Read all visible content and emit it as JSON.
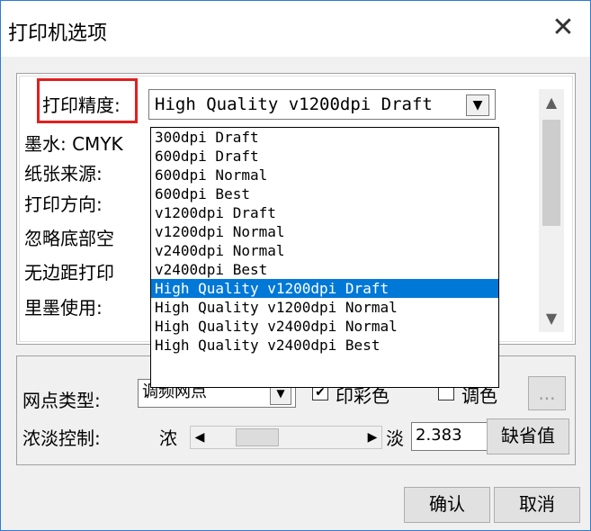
{
  "window": {
    "title": "打印机选项",
    "close_icon": "close-icon"
  },
  "settings": {
    "print_quality_label": "打印精度:",
    "print_quality_value": "High Quality v1200dpi Draft",
    "ink_label": "墨水: CMYK",
    "paper_source_label": "纸张来源:",
    "orientation_label": "打印方向:",
    "ignore_bottom_label": "忽略底部空",
    "borderless_label": "无边距打印",
    "black_ink_label": "里墨使用:"
  },
  "dropdown": {
    "options": [
      "300dpi Draft",
      "600dpi Draft",
      "600dpi Normal",
      "600dpi Best",
      "v1200dpi Draft",
      "v1200dpi Normal",
      "v2400dpi Normal",
      "v2400dpi Best",
      "High Quality v1200dpi Draft",
      "High Quality v1200dpi Normal",
      "High Quality v2400dpi Normal",
      "High Quality v2400dpi Best"
    ],
    "selected_index": 8
  },
  "halftone": {
    "label": "网点类型:",
    "value": "调频网点",
    "color_print_label": "印彩色",
    "color_print_checked": true,
    "adjust_color_label": "调色",
    "more_button": "..."
  },
  "density": {
    "label": "浓淡控制:",
    "dark": "浓",
    "light": "淡",
    "value": "2.383",
    "default_button": "缺省值"
  },
  "buttons": {
    "ok": "确认",
    "cancel": "取消"
  }
}
